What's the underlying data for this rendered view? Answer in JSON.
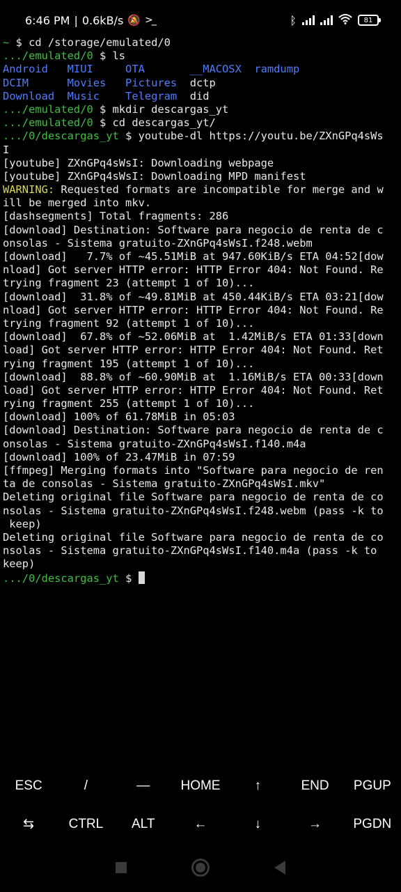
{
  "status_bar": {
    "time": "6:46 PM",
    "separator": "|",
    "speed": "0.6kB/s",
    "battery": "81",
    "icons": [
      "bell-off-icon",
      "terminal-prompt-icon",
      "bluetooth-icon",
      "signal-icon",
      "signal-icon",
      "wifi-icon",
      "battery-icon"
    ]
  },
  "terminal": {
    "lines": [
      [
        {
          "c": "g",
          "t": "~ "
        },
        {
          "c": "w",
          "t": "$ cd /storage/emulated/0"
        }
      ],
      [
        {
          "c": "g",
          "t": ".../emulated/0 "
        },
        {
          "c": "w",
          "t": "$ ls"
        }
      ],
      [
        {
          "c": "b",
          "t": "Android   MIUI     OTA       __MACOSX  ramdump"
        }
      ],
      [
        {
          "c": "b",
          "t": "DCIM      Movies   Pictures  "
        },
        {
          "c": "w",
          "t": "dctp"
        }
      ],
      [
        {
          "c": "b",
          "t": "Download  Music    Telegram  "
        },
        {
          "c": "w",
          "t": "did"
        }
      ],
      [
        {
          "c": "g",
          "t": ".../emulated/0 "
        },
        {
          "c": "w",
          "t": "$ mkdir descargas_yt"
        }
      ],
      [
        {
          "c": "g",
          "t": ".../emulated/0 "
        },
        {
          "c": "w",
          "t": "$ cd descargas_yt/"
        }
      ],
      [
        {
          "c": "g",
          "t": ".../0/descargas_yt "
        },
        {
          "c": "w",
          "t": "$ youtube-dl https://youtu.be/ZXnGPq4sWs"
        }
      ],
      [
        {
          "c": "w",
          "t": "I"
        }
      ],
      [
        {
          "c": "w",
          "t": "[youtube] ZXnGPq4sWsI: Downloading webpage"
        }
      ],
      [
        {
          "c": "w",
          "t": "[youtube] ZXnGPq4sWsI: Downloading MPD manifest"
        }
      ],
      [
        {
          "c": "y",
          "t": "WARNING:"
        },
        {
          "c": "w",
          "t": " Requested formats are incompatible for merge and w"
        }
      ],
      [
        {
          "c": "w",
          "t": "ill be merged into mkv."
        }
      ],
      [
        {
          "c": "w",
          "t": "[dashsegments] Total fragments: 286"
        }
      ],
      [
        {
          "c": "w",
          "t": "[download] Destination: Software para negocio de renta de c"
        }
      ],
      [
        {
          "c": "w",
          "t": "onsolas - Sistema gratuito-ZXnGPq4sWsI.f248.webm"
        }
      ],
      [
        {
          "c": "w",
          "t": "[download]   7.7% of ~45.51MiB at 947.60KiB/s ETA 04:52[dow"
        }
      ],
      [
        {
          "c": "w",
          "t": "nload] Got server HTTP error: HTTP Error 404: Not Found. Re"
        }
      ],
      [
        {
          "c": "w",
          "t": "trying fragment 23 (attempt 1 of 10)..."
        }
      ],
      [
        {
          "c": "w",
          "t": "[download]  31.8% of ~49.81MiB at 450.44KiB/s ETA 03:21[dow"
        }
      ],
      [
        {
          "c": "w",
          "t": "nload] Got server HTTP error: HTTP Error 404: Not Found. Re"
        }
      ],
      [
        {
          "c": "w",
          "t": "trying fragment 92 (attempt 1 of 10)..."
        }
      ],
      [
        {
          "c": "w",
          "t": "[download]  67.8% of ~52.06MiB at  1.42MiB/s ETA 01:33[down"
        }
      ],
      [
        {
          "c": "w",
          "t": "load] Got server HTTP error: HTTP Error 404: Not Found. Ret"
        }
      ],
      [
        {
          "c": "w",
          "t": "rying fragment 195 (attempt 1 of 10)..."
        }
      ],
      [
        {
          "c": "w",
          "t": "[download]  88.8% of ~60.90MiB at  1.16MiB/s ETA 00:33[down"
        }
      ],
      [
        {
          "c": "w",
          "t": "load] Got server HTTP error: HTTP Error 404: Not Found. Ret"
        }
      ],
      [
        {
          "c": "w",
          "t": "rying fragment 255 (attempt 1 of 10)..."
        }
      ],
      [
        {
          "c": "w",
          "t": "[download] 100% of 61.78MiB in 05:03"
        }
      ],
      [
        {
          "c": "w",
          "t": "[download] Destination: Software para negocio de renta de c"
        }
      ],
      [
        {
          "c": "w",
          "t": "onsolas - Sistema gratuito-ZXnGPq4sWsI.f140.m4a"
        }
      ],
      [
        {
          "c": "w",
          "t": "[download] 100% of 23.47MiB in 07:59"
        }
      ],
      [
        {
          "c": "w",
          "t": "[ffmpeg] Merging formats into \"Software para negocio de ren"
        }
      ],
      [
        {
          "c": "w",
          "t": "ta de consolas - Sistema gratuito-ZXnGPq4sWsI.mkv\""
        }
      ],
      [
        {
          "c": "w",
          "t": "Deleting original file Software para negocio de renta de co"
        }
      ],
      [
        {
          "c": "w",
          "t": "nsolas - Sistema gratuito-ZXnGPq4sWsI.f248.webm (pass -k to"
        }
      ],
      [
        {
          "c": "w",
          "t": " keep)"
        }
      ],
      [
        {
          "c": "w",
          "t": "Deleting original file Software para negocio de renta de co"
        }
      ],
      [
        {
          "c": "w",
          "t": "nsolas - Sistema gratuito-ZXnGPq4sWsI.f140.m4a (pass -k to"
        }
      ],
      [
        {
          "c": "w",
          "t": "keep)"
        }
      ]
    ],
    "prompt_path": ".../0/descargas_yt ",
    "prompt_symbol": "$ "
  },
  "extra_keys": {
    "row1": [
      {
        "name": "esc-key",
        "label": "ESC"
      },
      {
        "name": "slash-key",
        "label": "/"
      },
      {
        "name": "dash-key",
        "label": "—"
      },
      {
        "name": "home-key",
        "label": "HOME"
      },
      {
        "name": "arrow-up-key",
        "label": "↑"
      },
      {
        "name": "end-key",
        "label": "END"
      },
      {
        "name": "pgup-key",
        "label": "PGUP"
      }
    ],
    "row2": [
      {
        "name": "tab-key",
        "label": "⇆"
      },
      {
        "name": "ctrl-key",
        "label": "CTRL"
      },
      {
        "name": "alt-key",
        "label": "ALT"
      },
      {
        "name": "arrow-left-key",
        "label": "←"
      },
      {
        "name": "arrow-down-key",
        "label": "↓"
      },
      {
        "name": "arrow-right-key",
        "label": "→"
      },
      {
        "name": "pgdn-key",
        "label": "PGDN"
      }
    ]
  }
}
